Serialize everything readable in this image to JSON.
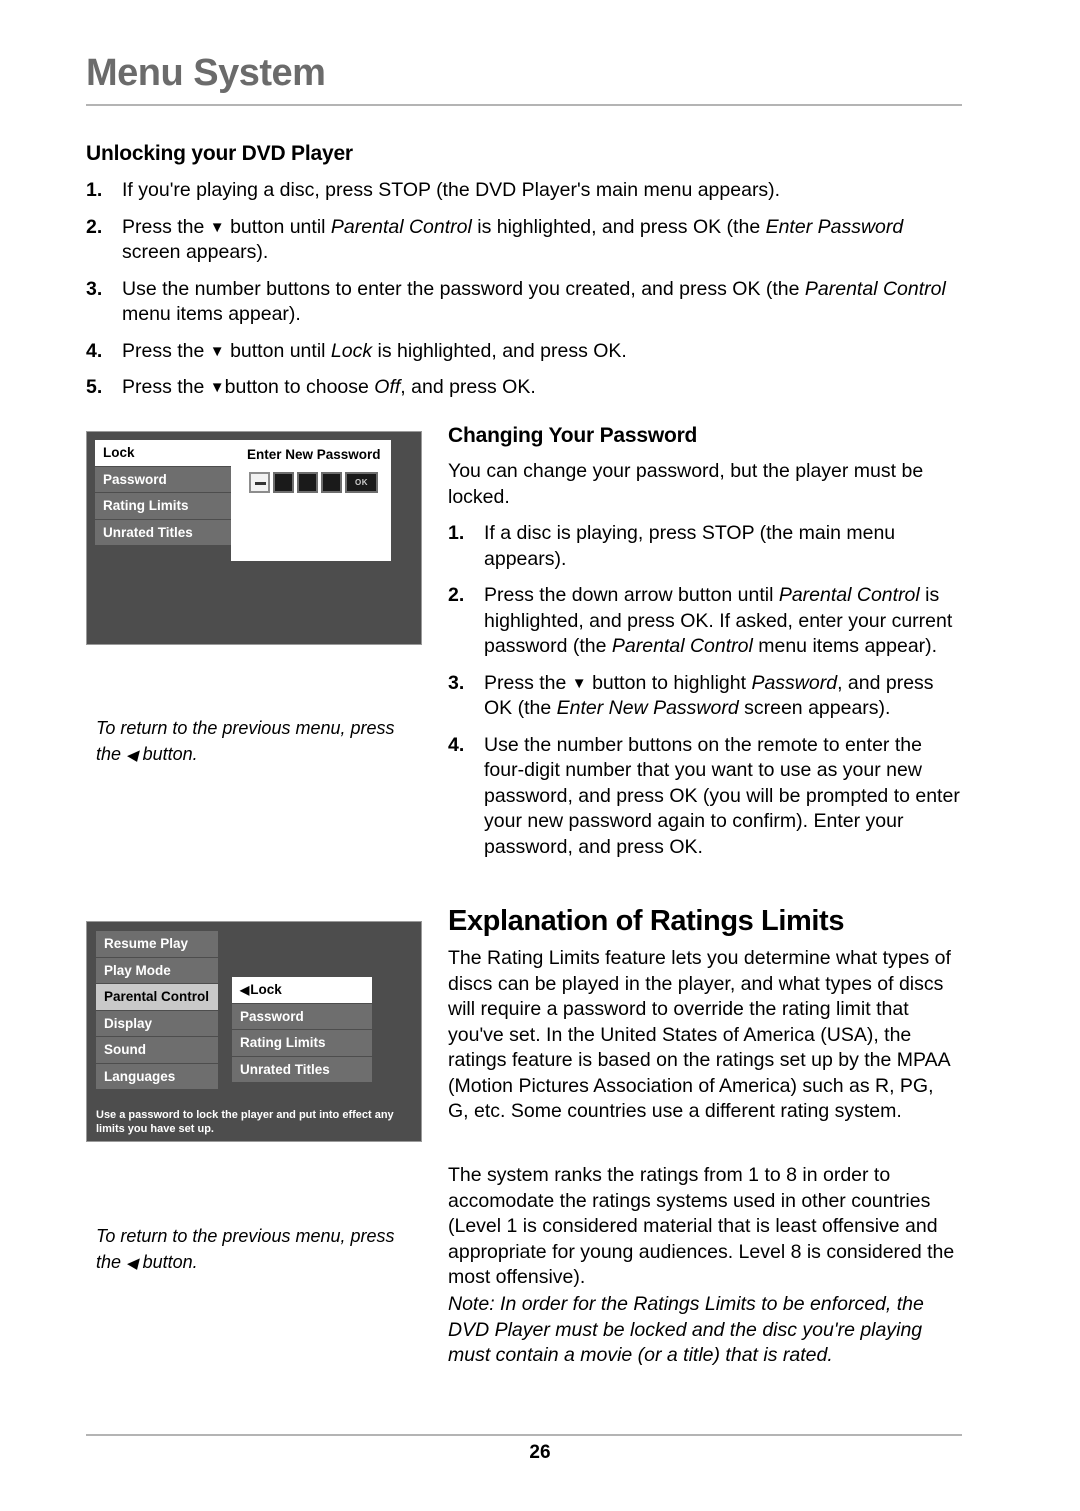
{
  "header": {
    "chapter_title": "Menu System"
  },
  "footer": {
    "page_number": "26"
  },
  "section_unlock": {
    "heading": "Unlocking your DVD Player",
    "steps": [
      {
        "num": "1.",
        "parts": [
          {
            "t": "If you're playing a disc, press STOP (the DVD Player's main menu appears).",
            "style": "normal"
          }
        ]
      },
      {
        "num": "2.",
        "parts": [
          {
            "t": "Press the ",
            "style": "normal"
          },
          {
            "t": "▼",
            "style": "arrow-down"
          },
          {
            "t": " button until ",
            "style": "normal"
          },
          {
            "t": "Parental Control",
            "style": "italic"
          },
          {
            "t": " is highlighted, and press OK (the ",
            "style": "normal"
          },
          {
            "t": "Enter Password",
            "style": "italic"
          },
          {
            "t": " screen appears).",
            "style": "normal"
          }
        ]
      },
      {
        "num": "3.",
        "parts": [
          {
            "t": "Use the number buttons to enter the password you created, and press OK (the ",
            "style": "normal"
          },
          {
            "t": "Parental Control",
            "style": "italic"
          },
          {
            "t": " menu items appear).",
            "style": "normal"
          }
        ]
      },
      {
        "num": "4.",
        "parts": [
          {
            "t": "Press the ",
            "style": "normal"
          },
          {
            "t": "▼",
            "style": "arrow-down"
          },
          {
            "t": " button until ",
            "style": "normal"
          },
          {
            "t": "Lock",
            "style": "italic"
          },
          {
            "t": " is highlighted, and press OK.",
            "style": "normal"
          }
        ]
      },
      {
        "num": "5.",
        "parts": [
          {
            "t": "Press the ",
            "style": "normal"
          },
          {
            "t": "▼",
            "style": "arrow-down"
          },
          {
            "t": "button to choose ",
            "style": "normal"
          },
          {
            "t": "Off",
            "style": "italic"
          },
          {
            "t": ", and press OK.",
            "style": "normal"
          }
        ]
      }
    ]
  },
  "section_password": {
    "heading": "Changing Your Password",
    "intro": "You can change your password, but the player must be locked.",
    "steps": [
      {
        "num": "1.",
        "parts": [
          {
            "t": "If a disc is playing, press STOP (the main menu appears).",
            "style": "normal"
          }
        ]
      },
      {
        "num": "2.",
        "parts": [
          {
            "t": "Press the down arrow button until ",
            "style": "normal"
          },
          {
            "t": "Parental Control",
            "style": "italic"
          },
          {
            "t": " is highlighted, and press OK. If asked, enter your current password (the ",
            "style": "normal"
          },
          {
            "t": "Parental Control",
            "style": "italic"
          },
          {
            "t": "  menu items appear).",
            "style": "normal"
          }
        ]
      },
      {
        "num": "3.",
        "parts": [
          {
            "t": "Press the ",
            "style": "normal"
          },
          {
            "t": "▼",
            "style": "arrow-down"
          },
          {
            "t": " button to highlight ",
            "style": "normal"
          },
          {
            "t": "Password",
            "style": "italic"
          },
          {
            "t": ", and press OK (the ",
            "style": "normal"
          },
          {
            "t": "Enter New Password",
            "style": "italic"
          },
          {
            "t": " screen appears).",
            "style": "normal"
          }
        ]
      },
      {
        "num": "4.",
        "parts": [
          {
            "t": "Use the number buttons on the remote to enter the four-digit number that you want to use as your new password, and press OK (you will be prompted to enter your new password again to confirm). Enter your password, and press OK.",
            "style": "normal"
          }
        ]
      }
    ]
  },
  "section_ratings": {
    "heading": "Explanation of Ratings Limits",
    "paragraph_1": "The Rating Limits feature lets you determine what types of discs can be played in the player, and what types of discs will require a password to override the rating limit that you've set. In the United States of America (USA), the ratings feature is based on the ratings set up by the MPAA (Motion Pictures Association of America) such as R, PG, G, etc. Some countries use a different rating system.",
    "paragraph_2": "The system ranks the ratings from 1 to 8 in order to accomodate the ratings systems used in other countries (Level 1 is considered material that is least offensive and appropriate for young audiences. Level 8 is considered the most offensive).",
    "note": "Note: In order for the Ratings Limits to be enforced, the DVD Player must be locked and the disc you're playing must contain a movie (or a title) that is rated."
  },
  "figure_1": {
    "menu_items": [
      {
        "label": "Lock",
        "selected": true
      },
      {
        "label": "Password",
        "selected": false
      },
      {
        "label": "Rating Limits",
        "selected": false
      },
      {
        "label": "Unrated Titles",
        "selected": false
      }
    ],
    "dialog": {
      "title": "Enter New Password",
      "digit_count": 4,
      "active_digit_index": 0,
      "ok_label": "OK"
    },
    "caption_line_1": "To return to the previous menu, press",
    "caption_line_2_before": "the ",
    "caption_arrow": "◀",
    "caption_line_2_after": " button."
  },
  "figure_2": {
    "main_menu_items": [
      {
        "label": "Resume Play",
        "selected": false
      },
      {
        "label": "Play Mode",
        "selected": false
      },
      {
        "label": "Parental Control",
        "selected": true
      },
      {
        "label": "Display",
        "selected": false
      },
      {
        "label": "Sound",
        "selected": false
      },
      {
        "label": "Languages",
        "selected": false
      }
    ],
    "submenu_items": [
      {
        "label": "Lock",
        "selected": true,
        "arrow": "◀"
      },
      {
        "label": "Password",
        "selected": false,
        "arrow": ""
      },
      {
        "label": "Rating Limits",
        "selected": false,
        "arrow": ""
      },
      {
        "label": "Unrated Titles",
        "selected": false,
        "arrow": ""
      }
    ],
    "help_text_line_1": "Use a password to lock the player and put into effect any",
    "help_text_line_2": "limits you have set up.",
    "caption_line_1": "To return to the previous menu, press",
    "caption_line_2_before": "the ",
    "caption_arrow": "◀",
    "caption_line_2_after": " button."
  },
  "colors": {
    "chapter_title": "#6b6b6b",
    "rule": "#b4b4b4",
    "tv_background": "#4d4d4d",
    "menu_item_background": "#6e6e6e",
    "menu_item_selected_white": "#ffffff",
    "menu_item_selected_gray": "#c9c9c9"
  }
}
